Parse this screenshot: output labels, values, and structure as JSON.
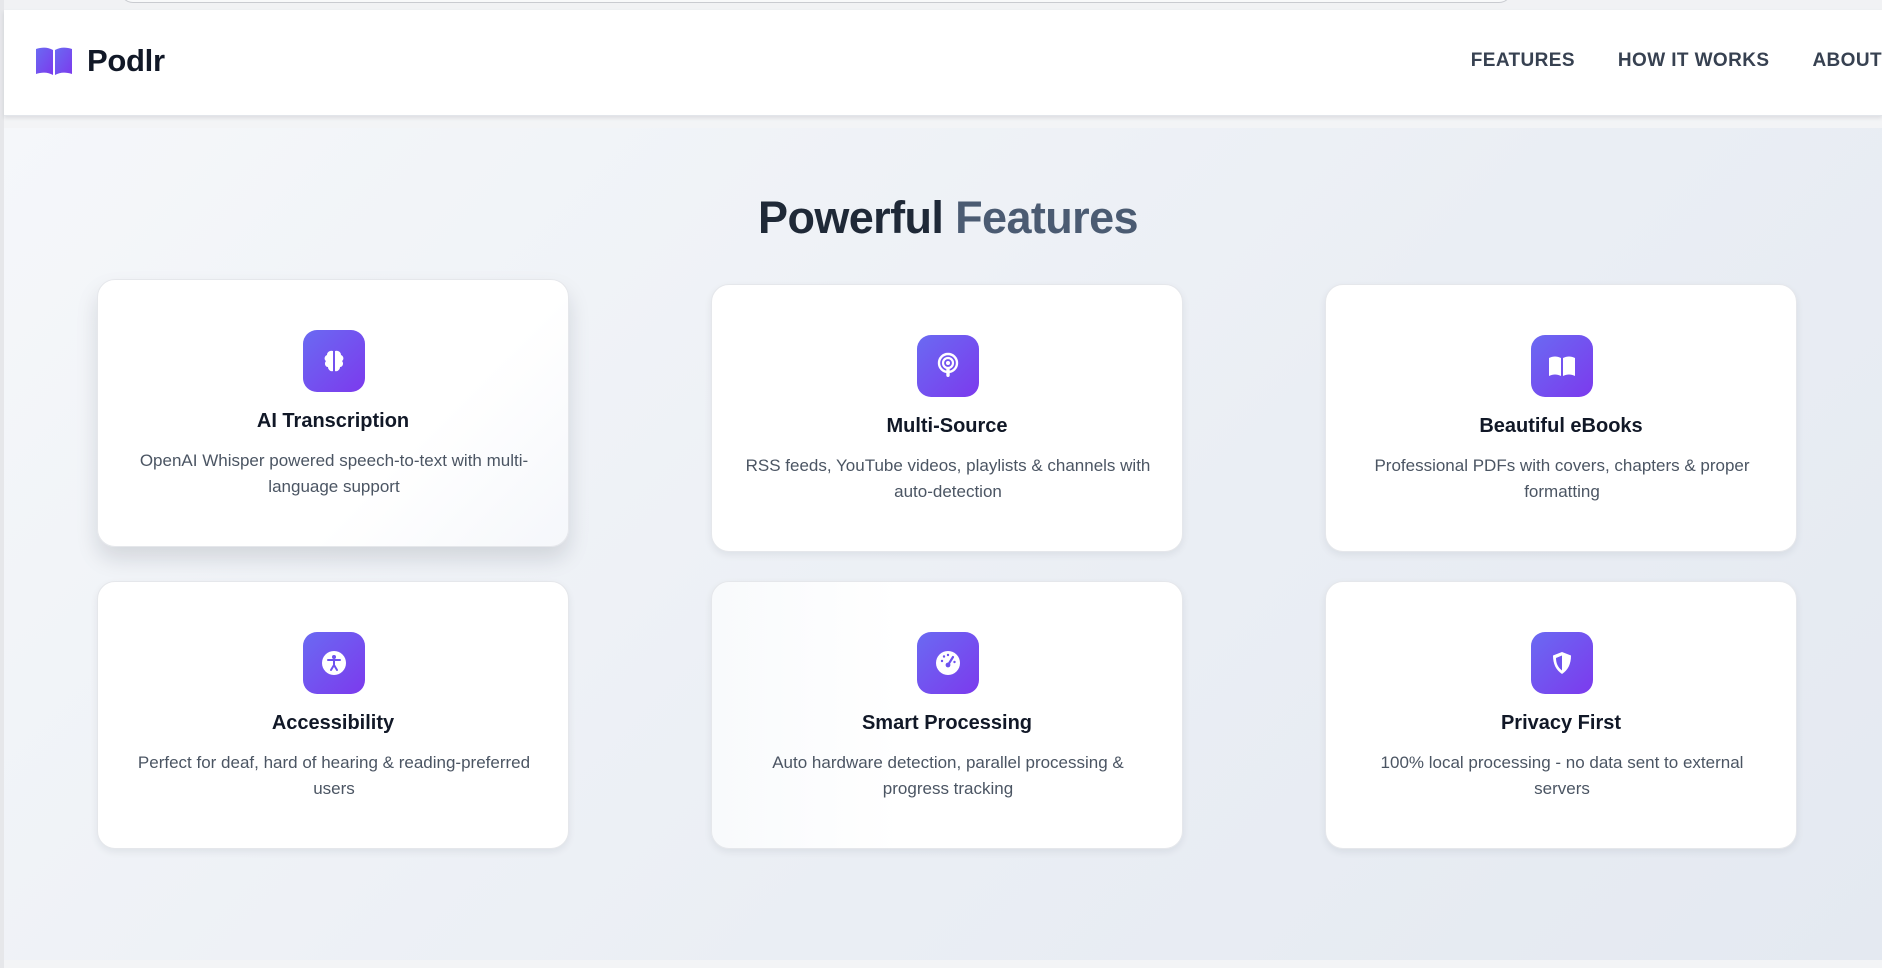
{
  "header": {
    "brand_icon": "book-icon",
    "brand_name": "Podlr",
    "nav": [
      "FEATURES",
      "HOW IT WORKS",
      "ABOUT"
    ]
  },
  "features": {
    "title_main": "Powerful",
    "title_accent": "Features",
    "cards": [
      {
        "icon": "brain-icon",
        "title": "AI Transcription",
        "description": "OpenAI Whisper powered speech-to-text with multi-language support"
      },
      {
        "icon": "podcast-icon",
        "title": "Multi-Source",
        "description": "RSS feeds, YouTube videos, playlists & channels with auto-detection"
      },
      {
        "icon": "book-open-icon",
        "title": "Beautiful eBooks",
        "description": "Professional PDFs with covers, chapters & proper formatting"
      },
      {
        "icon": "accessibility-icon",
        "title": "Accessibility",
        "description": "Perfect for deaf, hard of hearing & reading-preferred users"
      },
      {
        "icon": "gauge-icon",
        "title": "Smart Processing",
        "description": "Auto hardware detection, parallel processing & progress tracking"
      },
      {
        "icon": "shield-icon",
        "title": "Privacy First",
        "description": "100% local processing - no data sent to external servers"
      }
    ]
  },
  "colors": {
    "accent_gradient_start": "#6a6af2",
    "accent_gradient_end": "#7c3aed",
    "title_text": "#1f2937",
    "title_accent": "#4b5b72"
  }
}
